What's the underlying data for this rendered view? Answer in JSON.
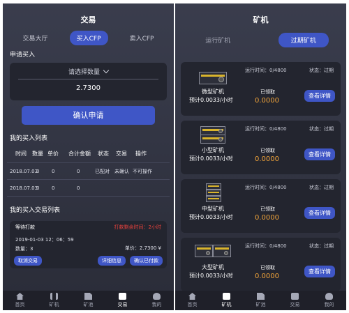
{
  "left": {
    "title": "交易",
    "tabs": [
      "交易大厅",
      "买入CFP",
      "卖入CFP"
    ],
    "buy_section": "申请买入",
    "quantity_placeholder": "请选择数量",
    "price": "2.7300",
    "confirm_button": "确认申请",
    "my_buy_list_title": "我的买入列表",
    "table_headers": [
      "时间",
      "数量",
      "单价",
      "合计金额",
      "状态",
      "交易",
      "操作"
    ],
    "rows": [
      [
        "2018.07.03",
        "0",
        "0",
        "0",
        "已配对",
        "未确认",
        "不可操作"
      ],
      [
        "2018.07.03",
        "0",
        "0",
        "0",
        "",
        "",
        ""
      ]
    ],
    "trade_list_title": "我的买入交易列表",
    "order": {
      "status": "等待打款",
      "countdown": "打款剩余时间：2小时",
      "date": "2019-01-03 12：06：59",
      "qty": "数量：3",
      "unit_price": "单价：2.7300 ¥",
      "cancel": "取消交易",
      "details": "详细信息",
      "confirm_paid": "确认已付款"
    }
  },
  "right": {
    "title": "矿机",
    "tabs": [
      "运行矿机",
      "过期矿机"
    ],
    "cards": [
      {
        "name": "微型矿机",
        "rate": "预计0.0033/小时",
        "runtime": "运行时间：0/4800",
        "status": "状态：过期",
        "collected_label": "已领取",
        "amount": "0.0000",
        "detail": "查看详情"
      },
      {
        "name": "小型矿机",
        "rate": "预计0.0033/小时",
        "runtime": "运行时间：0/4800",
        "status": "状态：过期",
        "collected_label": "已领取",
        "amount": "0.0000",
        "detail": "查看详情"
      },
      {
        "name": "中型矿机",
        "rate": "预计0.0033/小时",
        "runtime": "运行时间：0/4800",
        "status": "状态：过期",
        "collected_label": "已领取",
        "amount": "0.0000",
        "detail": "查看详情"
      },
      {
        "name": "大型矿机",
        "rate": "预计0.0033/小时",
        "runtime": "运行时间：0/4800",
        "status": "状态：过期",
        "collected_label": "已领取",
        "amount": "0.0000",
        "detail": "查看详情"
      }
    ]
  },
  "tabbar": [
    {
      "label": "首页",
      "icon": "home-icon"
    },
    {
      "label": "矿机",
      "icon": "miner-icon"
    },
    {
      "label": "矿池",
      "icon": "pool-icon"
    },
    {
      "label": "交易",
      "icon": "trade-icon"
    },
    {
      "label": "我的",
      "icon": "me-icon"
    }
  ],
  "colors": {
    "accent": "#3f56c6",
    "background": "#2e3040",
    "amount": "#f0a33a",
    "warning": "#e8413c"
  }
}
